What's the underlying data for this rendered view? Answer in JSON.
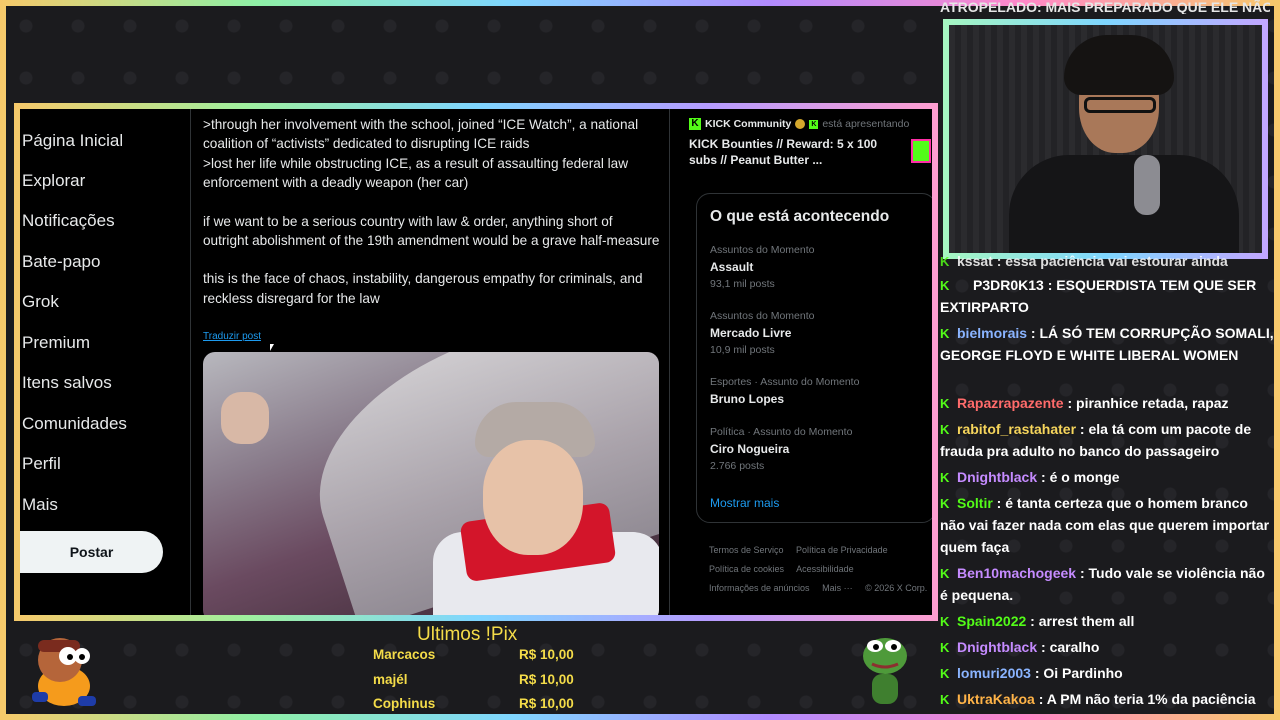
{
  "overlay_title": "ATROPELADO: MAIS PREPARADO QUE ELE NÃO",
  "colors": {
    "kick_green": "#53fc18",
    "x_blue": "#1d9bf0",
    "pix_yellow": "#f4dc49"
  },
  "sidebar": {
    "items": [
      {
        "label": "Página Inicial"
      },
      {
        "label": "Explorar"
      },
      {
        "label": "Notificações"
      },
      {
        "label": "Bate-papo"
      },
      {
        "label": "Grok"
      },
      {
        "label": "Premium"
      },
      {
        "label": "Itens salvos"
      },
      {
        "label": "Comunidades"
      },
      {
        "label": "Perfil"
      },
      {
        "label": "Mais"
      }
    ],
    "post_button": "Postar"
  },
  "post": {
    "paragraphs": [
      ">through her involvement with the school, joined “ICE Watch”, a national coalition of “activists” dedicated to disrupting ICE raids",
      ">lost her life while obstructing ICE, as a result of assaulting federal law enforcement with a deadly weapon (her car)",
      "if we want to be a serious country with law & order, anything short of outright abolishment of the 19th amendment would be a grave half-measure",
      "this is the face of chaos, instability, dangerous empathy for criminals, and reckless disregard for the law"
    ],
    "translate_link": "Traduzir post"
  },
  "kick_card": {
    "name": "KICK Community",
    "sub": "está apresentando",
    "title": "KICK Bounties // Reward: 5 x 100 subs // Peanut Butter ..."
  },
  "trending": {
    "heading": "O que está acontecendo",
    "items": [
      {
        "category": "Assuntos do Momento",
        "name": "Assault",
        "count": "93,1 mil posts"
      },
      {
        "category": "Assuntos do Momento",
        "name": "Mercado Livre",
        "count": "10,9 mil posts"
      },
      {
        "category": "Esportes · Assunto do Momento",
        "name": "Bruno Lopes",
        "count": ""
      },
      {
        "category": "Política · Assunto do Momento",
        "name": "Ciro Nogueira",
        "count": "2.766 posts"
      }
    ],
    "show_more": "Mostrar mais"
  },
  "footer": {
    "links": [
      "Termos de Serviço",
      "Política de Privacidade",
      "Política de cookies",
      "Acessibilidade",
      "Informações de anúncios",
      "Mais ···",
      "© 2026 X Corp."
    ]
  },
  "chat": {
    "messages": [
      {
        "user": "kssat",
        "color": "#ffffff",
        "text": "essa paciência vai estourar ainda"
      },
      {
        "user": "P3DR0K13",
        "color": "#ffffff",
        "text": "ESQUERDISTA TEM QUE SER EXTIRPARTO"
      },
      {
        "user": "bielmorais",
        "color": "#8ab4ff",
        "text": "LÁ SÓ TEM CORRUPÇÃO SOMALI, GEORGE FLOYD E WHITE LIBERAL WOMEN"
      },
      {
        "user": "Rapazrapazente",
        "color": "#ff6b6b",
        "text": "piranhice retada, rapaz"
      },
      {
        "user": "rabitof_rastahater",
        "color": "#f6d55c",
        "text": "ela tá com um pacote de frauda pra adulto no banco do passageiro"
      },
      {
        "user": "Dnightblack",
        "color": "#c58bff",
        "text": "é o monge"
      },
      {
        "user": "Soltir",
        "color": "#53fc18",
        "text": "é tanta certeza que o homem branco não vai fazer nada com elas que querem importar quem faça"
      },
      {
        "user": "Ben10machogeek",
        "color": "#c58bff",
        "text": "Tudo vale se violência não é pequena."
      },
      {
        "user": "Spain2022",
        "color": "#53fc18",
        "text": "arrest them all"
      },
      {
        "user": "Dnightblack",
        "color": "#c58bff",
        "text": "caralho"
      },
      {
        "user": "lomuri2003",
        "color": "#8ab4ff",
        "text": "Oi Pardinho"
      },
      {
        "user": "UktraKakoa",
        "color": "#ffb347",
        "text": "A PM não teria 1% da paciência"
      }
    ]
  },
  "pix": {
    "title": "Ultimos !Pix",
    "rows": [
      {
        "name": "Marcacos",
        "value": "R$ 10,00"
      },
      {
        "name": "majél",
        "value": "R$ 10,00"
      },
      {
        "name": "Cophinus",
        "value": "R$ 10,00"
      }
    ]
  }
}
